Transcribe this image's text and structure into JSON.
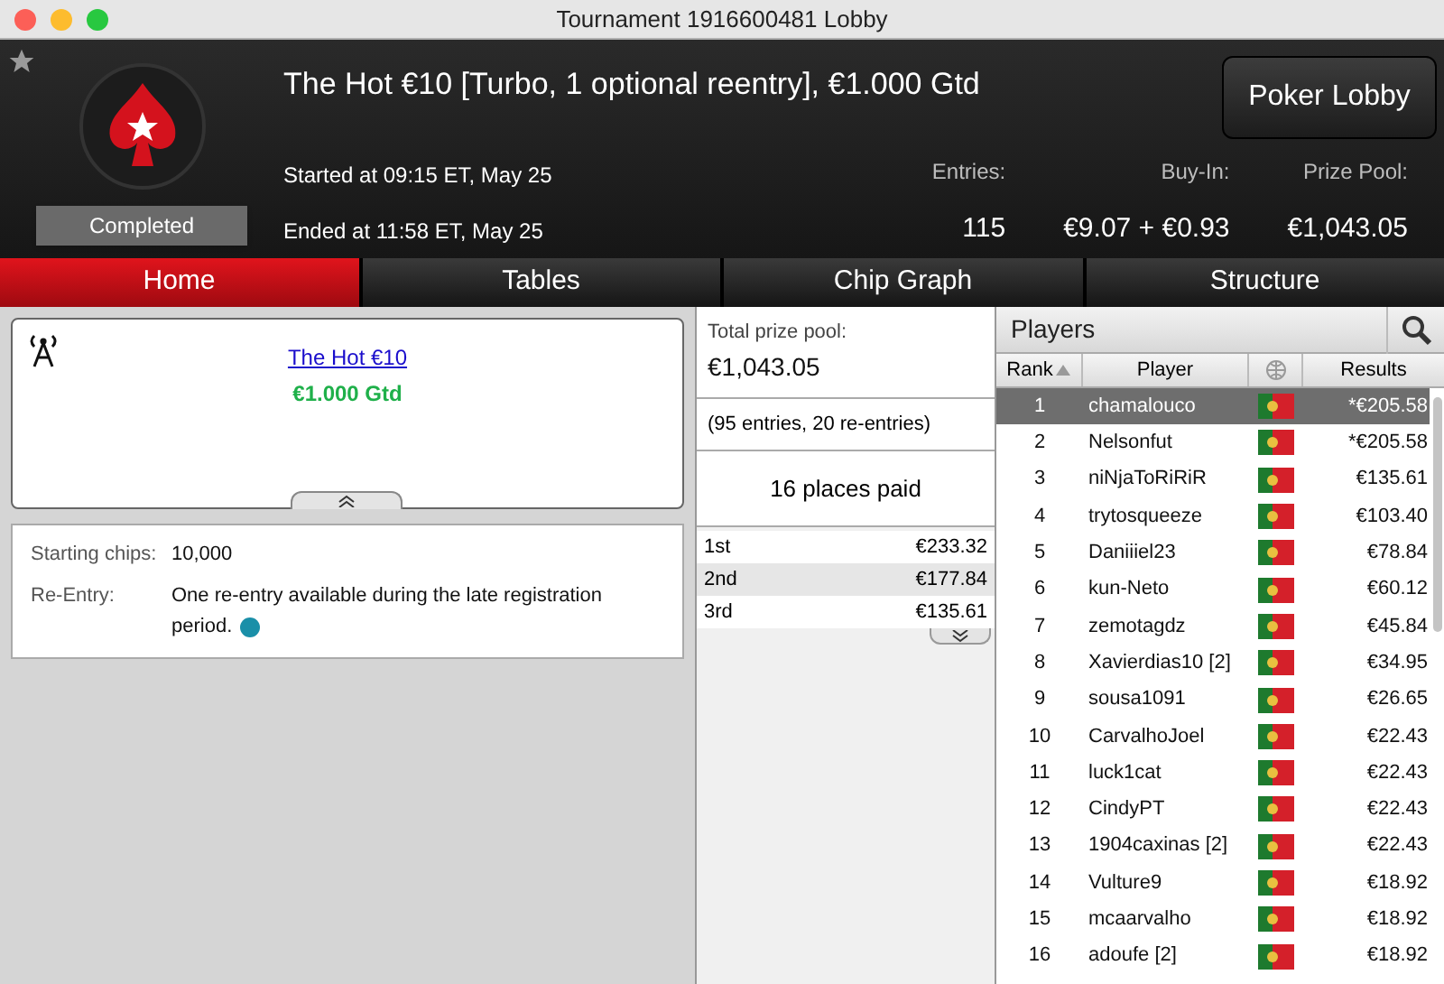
{
  "window": {
    "title": "Tournament 1916600481 Lobby"
  },
  "header": {
    "title": "The Hot €10 [Turbo, 1 optional reentry], €1.000 Gtd",
    "status": "Completed",
    "started": "Started at 09:15 ET, May 25",
    "ended": "Ended at 11:58 ET, May 25",
    "favorite": false,
    "lobby_button": "Poker Lobby",
    "stats": [
      {
        "label": "Entries:",
        "value": "115"
      },
      {
        "label": "Buy-In:",
        "value": "€9.07 + €0.93"
      },
      {
        "label": "Prize Pool:",
        "value": "€1,043.05"
      }
    ]
  },
  "tabs": [
    {
      "label": "Home",
      "selected": true
    },
    {
      "label": "Tables",
      "selected": false
    },
    {
      "label": "Chip Graph",
      "selected": false
    },
    {
      "label": "Structure",
      "selected": false
    }
  ],
  "info": {
    "link": "The Hot €10",
    "guarantee": "€1.000 Gtd",
    "details": [
      {
        "label": "Starting chips:",
        "value": "10,000"
      },
      {
        "label": "Re-Entry:",
        "value": "One re-entry available during the late registration period."
      }
    ]
  },
  "prizes": {
    "label": "Total prize pool:",
    "total": "€1,043.05",
    "entries": "(95 entries, 20 re-entries)",
    "paid": "16 places paid",
    "places": [
      {
        "place": "1st",
        "amount": "€233.32"
      },
      {
        "place": "2nd",
        "amount": "€177.84"
      },
      {
        "place": "3rd",
        "amount": "€135.61"
      }
    ]
  },
  "players": {
    "title": "Players",
    "columns": [
      "Rank",
      "Player",
      "Results"
    ],
    "rows": [
      {
        "rank": "1",
        "name": "chamalouco",
        "result": "*€205.58",
        "selected": true
      },
      {
        "rank": "2",
        "name": "Nelsonfut",
        "result": "*€205.58",
        "selected": false
      },
      {
        "rank": "3",
        "name": "niNjaToRiRiR",
        "result": "€135.61",
        "selected": false
      },
      {
        "rank": "4",
        "name": "trytosqueeze",
        "result": "€103.40",
        "selected": false
      },
      {
        "rank": "5",
        "name": "Daniiiel23",
        "result": "€78.84",
        "selected": false
      },
      {
        "rank": "6",
        "name": "kun-Neto",
        "result": "€60.12",
        "selected": false
      },
      {
        "rank": "7",
        "name": "zemotagdz",
        "result": "€45.84",
        "selected": false
      },
      {
        "rank": "8",
        "name": "Xavierdias10 [2]",
        "result": "€34.95",
        "selected": false
      },
      {
        "rank": "9",
        "name": "sousa1091",
        "result": "€26.65",
        "selected": false
      },
      {
        "rank": "10",
        "name": "CarvalhoJoel",
        "result": "€22.43",
        "selected": false
      },
      {
        "rank": "11",
        "name": "luck1cat",
        "result": "€22.43",
        "selected": false
      },
      {
        "rank": "12",
        "name": "CindyPT",
        "result": "€22.43",
        "selected": false
      },
      {
        "rank": "13",
        "name": "1904caxinas [2]",
        "result": "€22.43",
        "selected": false
      },
      {
        "rank": "14",
        "name": "Vulture9",
        "result": "€18.92",
        "selected": false
      },
      {
        "rank": "15",
        "name": "mcaarvalho",
        "result": "€18.92",
        "selected": false
      },
      {
        "rank": "16",
        "name": "adoufe [2]",
        "result": "€18.92",
        "selected": false
      }
    ]
  }
}
